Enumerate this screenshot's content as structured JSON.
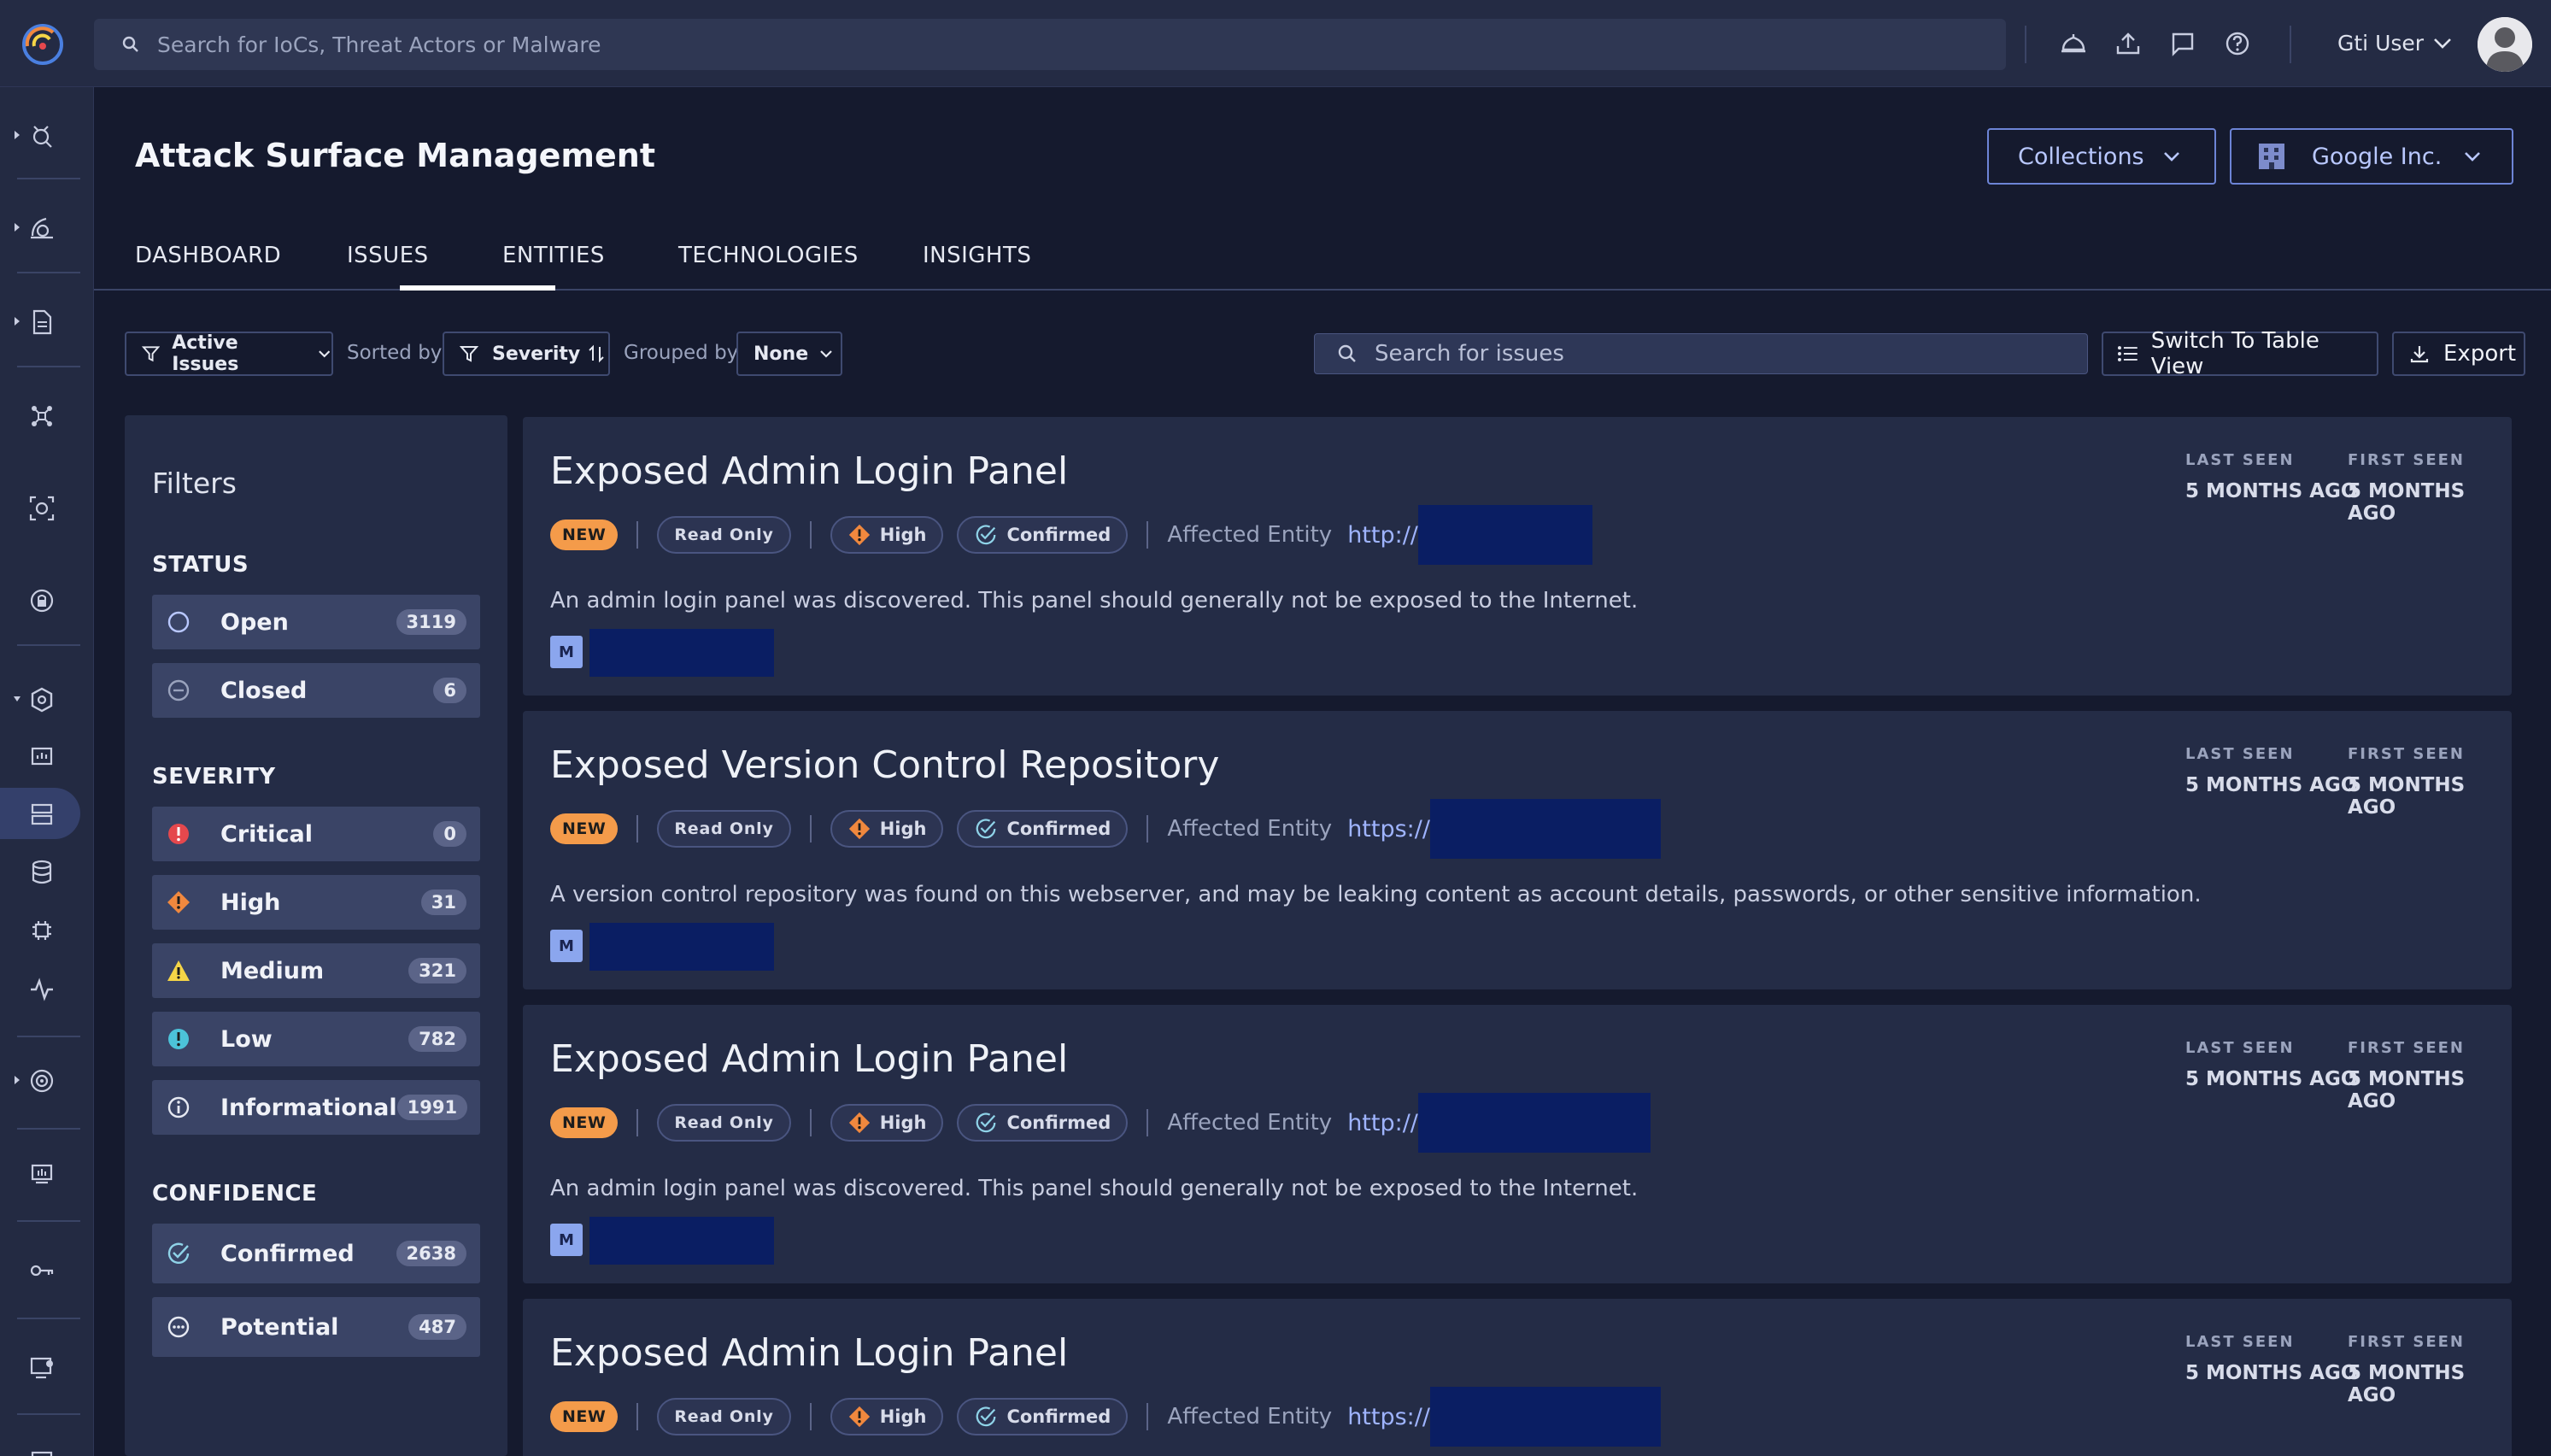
{
  "topbar": {
    "search_placeholder": "Search for IoCs, Threat Actors or Malware",
    "user_name": "Gti User"
  },
  "page": {
    "title": "Attack Surface Management",
    "collections_label": "Collections",
    "org_label": "Google Inc."
  },
  "tabs": [
    {
      "label": "DASHBOARD"
    },
    {
      "label": "ISSUES",
      "active": true
    },
    {
      "label": "ENTITIES"
    },
    {
      "label": "TECHNOLOGIES"
    },
    {
      "label": "INSIGHTS"
    }
  ],
  "toolbar": {
    "active_issues": "Active Issues",
    "sorted_by_label": "Sorted by",
    "sort_value": "Severity",
    "grouped_by_label": "Grouped by",
    "group_value": "None",
    "search_placeholder": "Search for issues",
    "switch_view": "Switch To Table View",
    "export": "Export"
  },
  "filters": {
    "title": "Filters",
    "status": {
      "heading": "STATUS",
      "items": [
        {
          "label": "Open",
          "count": "3119"
        },
        {
          "label": "Closed",
          "count": "6"
        }
      ]
    },
    "severity": {
      "heading": "SEVERITY",
      "items": [
        {
          "label": "Critical",
          "count": "0",
          "color": "#e5484d"
        },
        {
          "label": "High",
          "count": "31",
          "color": "#f0883e"
        },
        {
          "label": "Medium",
          "count": "321",
          "color": "#f5d547"
        },
        {
          "label": "Low",
          "count": "782",
          "color": "#4cc3d9"
        },
        {
          "label": "Informational",
          "count": "1991"
        }
      ]
    },
    "confidence": {
      "heading": "CONFIDENCE",
      "items": [
        {
          "label": "Confirmed",
          "count": "2638"
        },
        {
          "label": "Potential",
          "count": "487"
        }
      ]
    }
  },
  "issues": [
    {
      "title": "Exposed Admin Login Panel",
      "new_badge": "NEW",
      "read_only": "Read Only",
      "severity": "High",
      "confidence": "Confirmed",
      "affected_label": "Affected Entity",
      "url_prefix": "http://",
      "description": "An admin login panel was discovered. This panel should generally not be exposed to the Internet.",
      "m_label": "M",
      "last_seen_label": "LAST SEEN",
      "last_seen": "5 MONTHS AGO",
      "first_seen_label": "FIRST SEEN",
      "first_seen": "5 MONTHS AGO"
    },
    {
      "title": "Exposed Version Control Repository",
      "new_badge": "NEW",
      "read_only": "Read Only",
      "severity": "High",
      "confidence": "Confirmed",
      "affected_label": "Affected Entity",
      "url_prefix": "https://",
      "description": "A version control repository was found on this webserver, and may be leaking content as account details, passwords, or other sensitive information.",
      "m_label": "M",
      "last_seen_label": "LAST SEEN",
      "last_seen": "5 MONTHS AGO",
      "first_seen_label": "FIRST SEEN",
      "first_seen": "5 MONTHS AGO"
    },
    {
      "title": "Exposed Admin Login Panel",
      "new_badge": "NEW",
      "read_only": "Read Only",
      "severity": "High",
      "confidence": "Confirmed",
      "affected_label": "Affected Entity",
      "url_prefix": "http://",
      "description": "An admin login panel was discovered. This panel should generally not be exposed to the Internet.",
      "m_label": "M",
      "last_seen_label": "LAST SEEN",
      "last_seen": "5 MONTHS AGO",
      "first_seen_label": "FIRST SEEN",
      "first_seen": "5 MONTHS AGO"
    },
    {
      "title": "Exposed Admin Login Panel",
      "new_badge": "NEW",
      "read_only": "Read Only",
      "severity": "High",
      "confidence": "Confirmed",
      "affected_label": "Affected Entity",
      "url_prefix": "https://",
      "last_seen_label": "LAST SEEN",
      "last_seen": "5 MONTHS AGO",
      "first_seen_label": "FIRST SEEN",
      "first_seen": "5 MONTHS AGO"
    }
  ]
}
